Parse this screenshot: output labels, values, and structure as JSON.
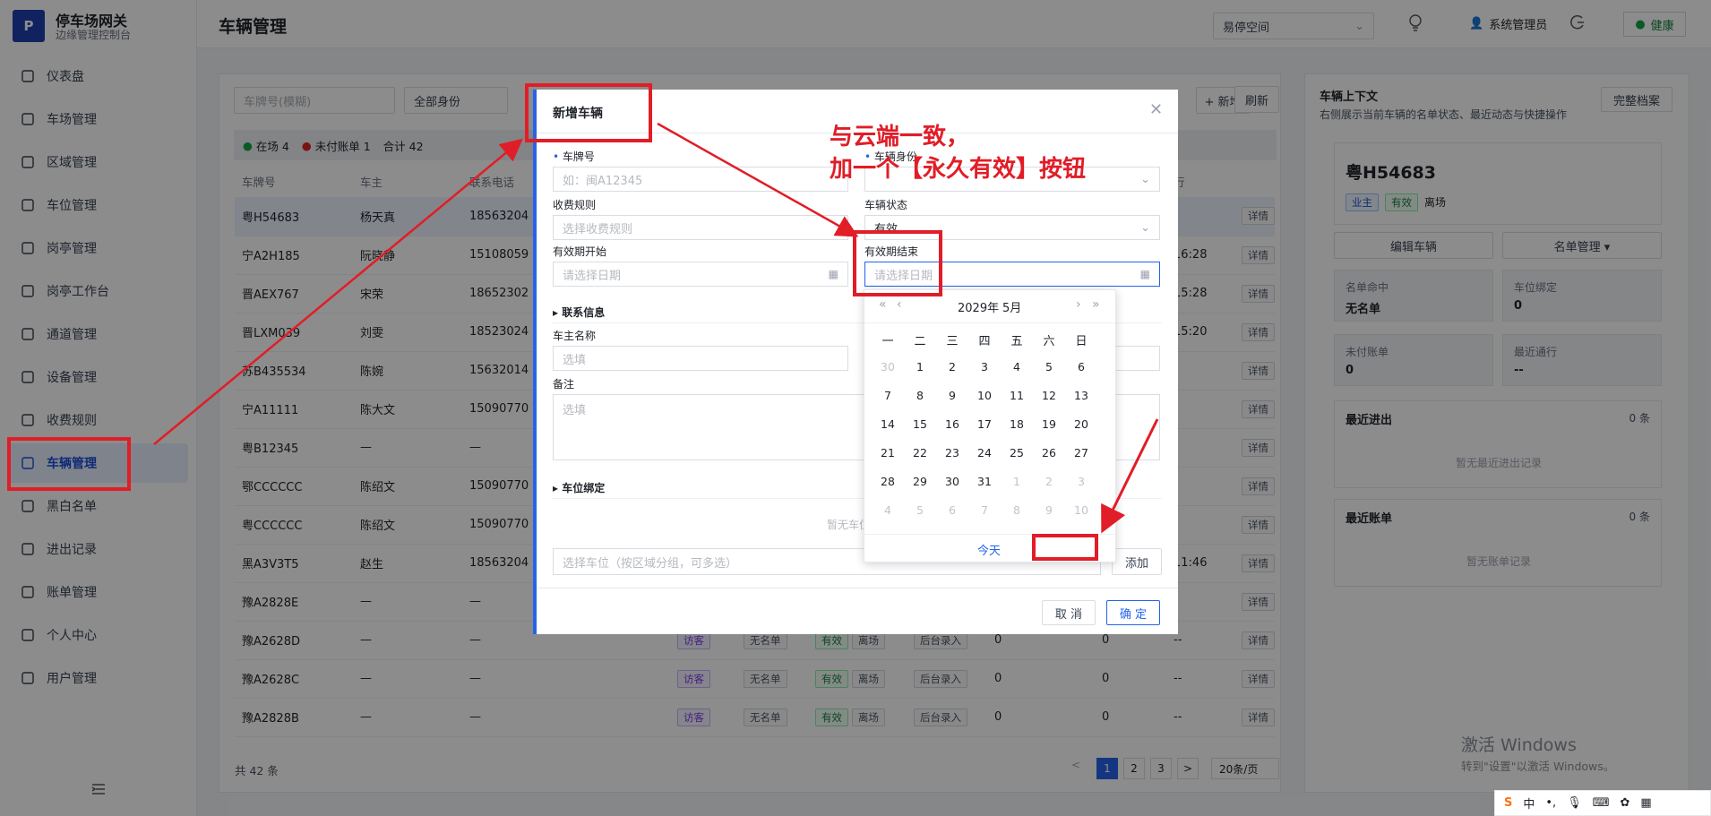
{
  "app": {
    "title": "停车场网关",
    "subtitle": "边缘管理控制台",
    "logo": "P"
  },
  "sidebar": {
    "items": [
      {
        "label": "仪表盘",
        "icon": "dashboard-icon"
      },
      {
        "label": "车场管理",
        "icon": "grid-icon"
      },
      {
        "label": "区域管理",
        "icon": "region-icon"
      },
      {
        "label": "车位管理",
        "icon": "table-icon"
      },
      {
        "label": "岗亭管理",
        "icon": "booth-icon"
      },
      {
        "label": "岗亭工作台",
        "icon": "monitor-icon"
      },
      {
        "label": "通道管理",
        "icon": "channel-icon"
      },
      {
        "label": "设备管理",
        "icon": "device-icon"
      },
      {
        "label": "收费规则",
        "icon": "fee-icon"
      },
      {
        "label": "车辆管理",
        "icon": "shield-icon"
      },
      {
        "label": "黑白名单",
        "icon": "shield-check-icon"
      },
      {
        "label": "进出记录",
        "icon": "car-icon"
      },
      {
        "label": "账单管理",
        "icon": "bill-icon"
      },
      {
        "label": "个人中心",
        "icon": "user-icon"
      },
      {
        "label": "用户管理",
        "icon": "user-icon"
      }
    ],
    "collapse_icon": "collapse-icon"
  },
  "header": {
    "page_title": "车辆管理",
    "lot_select": "易停空间",
    "user": "系统管理员",
    "status": "健康"
  },
  "filters": {
    "plate_placeholder": "车牌号(模糊)",
    "identity": "全部身份",
    "add": "+ 新增",
    "refresh": "刷新"
  },
  "summary": {
    "in_lot": "在场 4",
    "unpaid": "未付账单 1",
    "total": "合计 42"
  },
  "table": {
    "headers": [
      "车牌号",
      "车主",
      "联系电话",
      "",
      "",
      "",
      "",
      "",
      "",
      "行",
      ""
    ],
    "rows": [
      {
        "plate": "粤H54683",
        "owner": "杨天真",
        "phone": "18563204",
        "time": "",
        "action": "详情"
      },
      {
        "plate": "宁A2H185",
        "owner": "阮晓静",
        "phone": "15108059",
        "time": "16:28",
        "action": "详情"
      },
      {
        "plate": "晋AEX767",
        "owner": "宋荣",
        "phone": "18652302",
        "time": "15:28",
        "action": "详情"
      },
      {
        "plate": "晋LXM039",
        "owner": "刘雯",
        "phone": "18523024",
        "time": "15:20",
        "action": "详情"
      },
      {
        "plate": "苏B435534",
        "owner": "陈婉",
        "phone": "15632014",
        "time": "",
        "action": "详情"
      },
      {
        "plate": "宁A11111",
        "owner": "陈大文",
        "phone": "15090770",
        "time": "",
        "action": "详情"
      },
      {
        "plate": "粤B12345",
        "owner": "—",
        "phone": "—",
        "time": "",
        "action": "详情"
      },
      {
        "plate": "鄂CCCCCC",
        "owner": "陈绍文",
        "phone": "15090770",
        "time": "",
        "action": "详情"
      },
      {
        "plate": "粤CCCCCC",
        "owner": "陈绍文",
        "phone": "15090770",
        "time": "",
        "action": "详情"
      },
      {
        "plate": "黑A3V3T5",
        "owner": "赵生",
        "phone": "18563204",
        "time": "11:46",
        "action": "详情"
      },
      {
        "plate": "豫A2828E",
        "owner": "—",
        "phone": "—",
        "time": "",
        "action": "详情"
      },
      {
        "plate": "豫A2628D",
        "owner": "—",
        "phone": "—",
        "identity": "访客",
        "list": "无名单",
        "status": "有效",
        "presence": "离场",
        "source": "后台录入",
        "c1": "0",
        "c2": "0",
        "last": "--",
        "action": "详情"
      },
      {
        "plate": "豫A2628C",
        "owner": "—",
        "phone": "—",
        "identity": "访客",
        "list": "无名单",
        "status": "有效",
        "presence": "离场",
        "source": "后台录入",
        "c1": "0",
        "c2": "0",
        "last": "--",
        "action": "详情"
      },
      {
        "plate": "豫A2828B",
        "owner": "—",
        "phone": "—",
        "identity": "访客",
        "list": "无名单",
        "status": "有效",
        "presence": "离场",
        "source": "后台录入",
        "c1": "0",
        "c2": "0",
        "last": "--",
        "action": "详情"
      }
    ]
  },
  "pagination": {
    "total": "共 42 条",
    "pages": [
      "1",
      "2",
      "3"
    ],
    "prev": "<",
    "next": ">",
    "page_size": "20条/页"
  },
  "context_panel": {
    "title": "车辆上下文",
    "desc": "右侧展示当前车辆的名单状态、最近动态与快捷操作",
    "full_profile": "完整档案",
    "plate": "粤H54683",
    "tags": [
      "业主",
      "有效",
      "离场"
    ],
    "edit": "编辑车辆",
    "list_mgmt": "名单管理 ▾",
    "stats": [
      {
        "label": "名单命中",
        "value": "无名单"
      },
      {
        "label": "车位绑定",
        "value": "0"
      },
      {
        "label": "未付账单",
        "value": "0"
      },
      {
        "label": "最近通行",
        "value": "--"
      }
    ],
    "recent_io": {
      "title": "最近进出",
      "count": "0 条",
      "empty": "暂无最近进出记录"
    },
    "recent_bills": {
      "title": "最近账单",
      "count": "0 条",
      "empty": "暂无账单记录"
    }
  },
  "modal": {
    "title": "新增车辆",
    "plate_label": "车牌号",
    "plate_placeholder": "如：闽A12345",
    "identity_label": "车辆身份",
    "fee_label": "收费规则",
    "fee_placeholder": "选择收费规则",
    "status_label": "车辆状态",
    "status_value": "有效",
    "start_label": "有效期开始",
    "start_placeholder": "请选择日期",
    "end_label": "有效期结束",
    "end_placeholder": "请选择日期",
    "contact_section": "联系信息",
    "owner_label": "车主名称",
    "owner_placeholder": "选填",
    "remark_label": "备注",
    "remark_placeholder": "选填",
    "parking_section": "车位绑定",
    "no_parking": "暂无车位",
    "parking_placeholder": "选择车位（按区域分组，可多选）",
    "add": "添加",
    "cancel": "取 消",
    "confirm": "确 定"
  },
  "calendar": {
    "year": "2029年",
    "month": "5月",
    "weekdays": [
      "一",
      "二",
      "三",
      "四",
      "五",
      "六",
      "日"
    ],
    "days": [
      [
        "30",
        "1",
        "2",
        "3",
        "4",
        "5",
        "6"
      ],
      [
        "7",
        "8",
        "9",
        "10",
        "11",
        "12",
        "13"
      ],
      [
        "14",
        "15",
        "16",
        "17",
        "18",
        "19",
        "20"
      ],
      [
        "21",
        "22",
        "23",
        "24",
        "25",
        "26",
        "27"
      ],
      [
        "28",
        "29",
        "30",
        "31",
        "1",
        "2",
        "3"
      ],
      [
        "4",
        "5",
        "6",
        "7",
        "8",
        "9",
        "10"
      ]
    ],
    "today": "今天"
  },
  "annotation": {
    "line1": "与云端一致，",
    "line2": "加一个【永久有效】按钮"
  },
  "watermark": {
    "line1": "激活 Windows",
    "line2": "转到\"设置\"以激活 Windows。"
  },
  "ime": {
    "label": "中"
  }
}
